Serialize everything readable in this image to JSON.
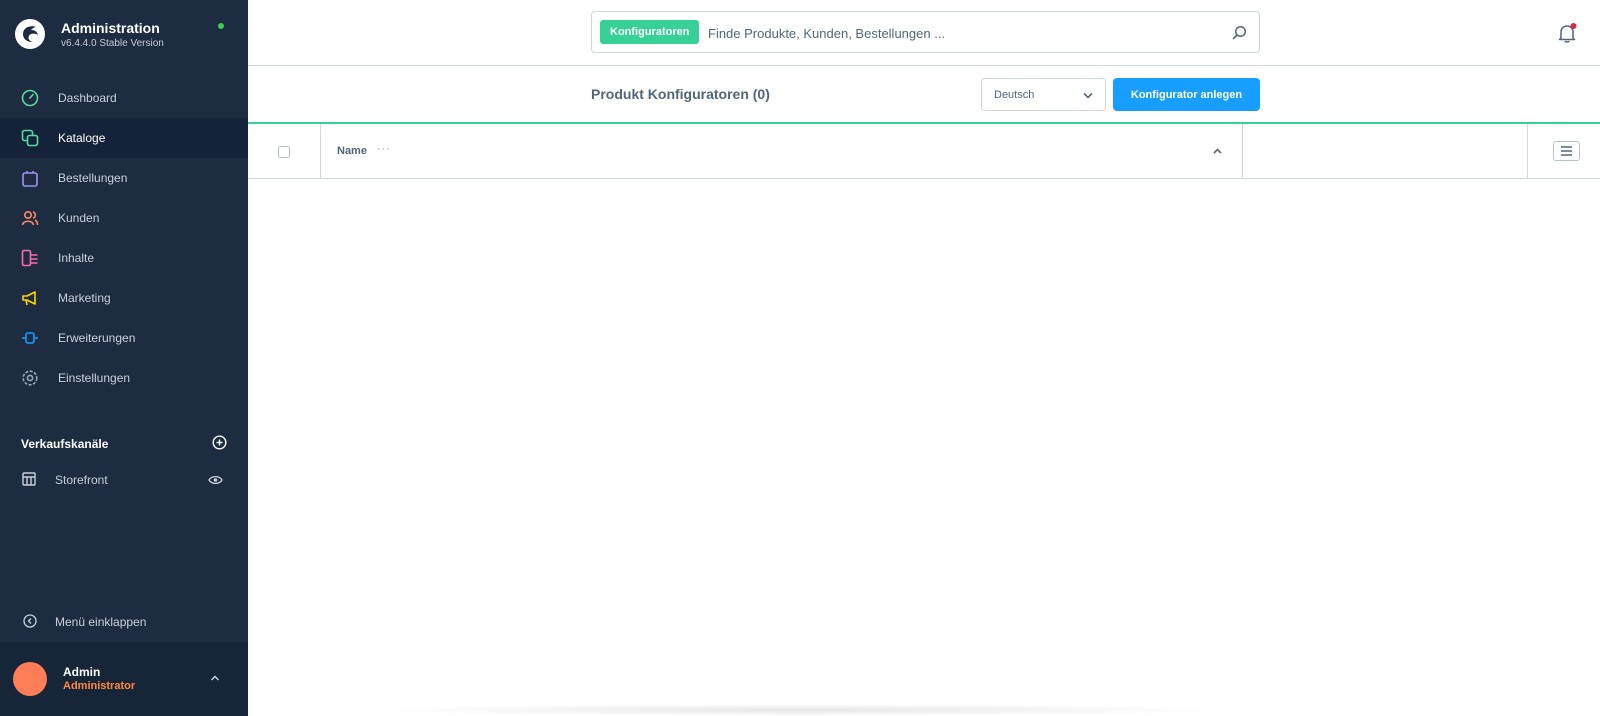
{
  "brand": {
    "title": "Administration",
    "version": "v6.4.4.0 Stable Version",
    "logo_icon": "shopware-logo-icon"
  },
  "sidebar": {
    "items": [
      {
        "label": "Dashboard",
        "icon": "dashboard-gauge-icon",
        "color": "#57d9a3"
      },
      {
        "label": "Kataloge",
        "icon": "catalog-icon",
        "color": "#57d9a3",
        "active": true
      },
      {
        "label": "Bestellungen",
        "icon": "orders-bag-icon",
        "color": "#a092f0"
      },
      {
        "label": "Kunden",
        "icon": "customers-icon",
        "color": "#f88962"
      },
      {
        "label": "Inhalte",
        "icon": "content-icon",
        "color": "#ff68b4"
      },
      {
        "label": "Marketing",
        "icon": "marketing-megaphone-icon",
        "color": "#ffd700"
      },
      {
        "label": "Erweiterungen",
        "icon": "extensions-plug-icon",
        "color": "#189eff"
      },
      {
        "label": "Einstellungen",
        "icon": "settings-gear-icon",
        "color": "#9aa8b5"
      }
    ],
    "sales_channels": {
      "label": "Verkaufskanäle",
      "items": [
        {
          "label": "Storefront"
        }
      ]
    },
    "collapse_label": "Menü einklappen",
    "user": {
      "name": "Admin",
      "role": "Administrator"
    }
  },
  "search": {
    "chip_label": "Konfiguratoren",
    "placeholder": "Finde Produkte, Kunden, Bestellungen ..."
  },
  "smartbar": {
    "heading": "Produkt Konfiguratoren (0)",
    "language": "Deutsch",
    "create_label": "Konfigurator anlegen"
  },
  "grid": {
    "columns": [
      {
        "label": "Name",
        "more": "···"
      }
    ]
  },
  "colors": {
    "sidebar_bg": "#1d2c41",
    "accent_green": "#37d097",
    "primary_blue": "#189eff",
    "avatar": "#ff7e57"
  }
}
